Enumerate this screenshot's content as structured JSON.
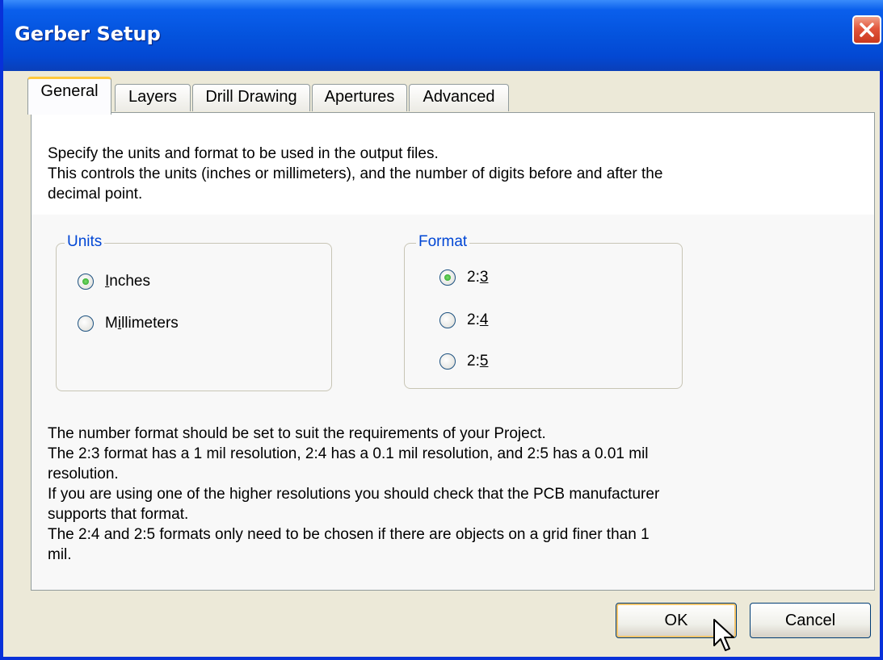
{
  "window": {
    "title": "Gerber Setup"
  },
  "tabs": [
    {
      "label": "General",
      "active": true
    },
    {
      "label": "Layers",
      "active": false
    },
    {
      "label": "Drill Drawing",
      "active": false
    },
    {
      "label": "Apertures",
      "active": false
    },
    {
      "label": "Advanced",
      "active": false
    }
  ],
  "intro": {
    "line1": "Specify the units and format to be used in the output files.",
    "line2": "This controls the units (inches or millimeters), and the number of digits before and after the",
    "line3": "decimal point."
  },
  "units": {
    "label": "Units",
    "options": [
      {
        "pre": "",
        "acc": "I",
        "post": "nches",
        "selected": true
      },
      {
        "pre": "M",
        "acc": "i",
        "post": "llimeters",
        "selected": false
      }
    ]
  },
  "format": {
    "label": "Format",
    "options": [
      {
        "pre": "2:",
        "acc": "3",
        "post": "",
        "selected": true
      },
      {
        "pre": "2:",
        "acc": "4",
        "post": "",
        "selected": false
      },
      {
        "pre": "2:",
        "acc": "5",
        "post": "",
        "selected": false
      }
    ]
  },
  "notes": {
    "l1": "The number format should be set to suit the requirements of your Project.",
    "l2": "The 2:3 format has a 1 mil resolution, 2:4 has a 0.1 mil resolution, and 2:5 has a 0.01 mil",
    "l3": "resolution.",
    "l4": "If you are using one of the higher resolutions you should check that the PCB manufacturer",
    "l5": "supports that format.",
    "l6": "The 2:4 and 2:5 formats only need to be chosen if there are objects on a grid finer than 1",
    "l7": "mil."
  },
  "buttons": {
    "ok": "OK",
    "cancel": "Cancel"
  },
  "colors": {
    "titlebar": "#0453dd",
    "group_label": "#0046d5",
    "close": "#e2553c"
  },
  "icons": {
    "close": "close-icon",
    "cursor": "mouse-cursor-icon"
  }
}
